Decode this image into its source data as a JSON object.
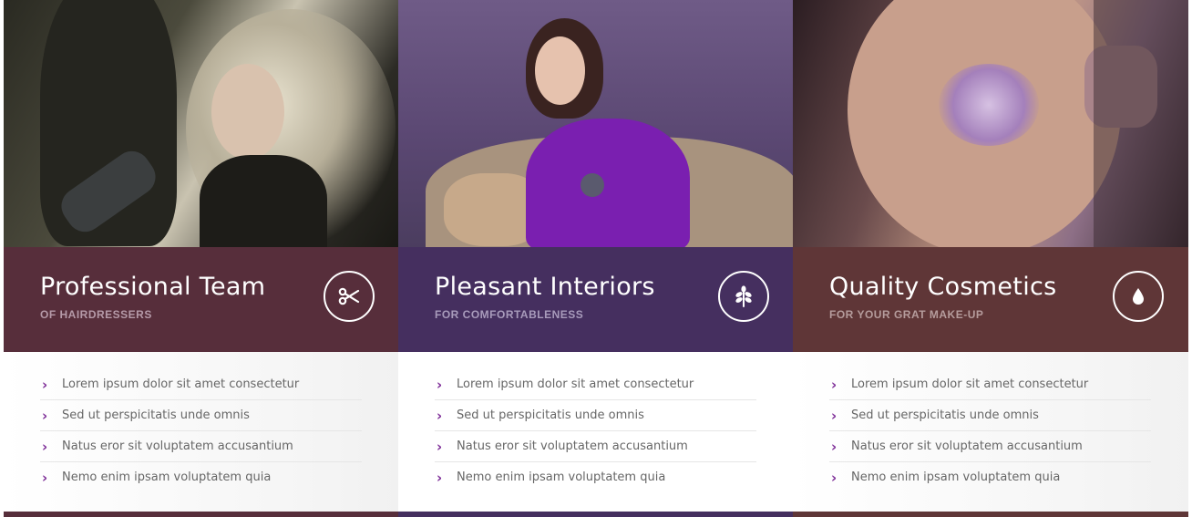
{
  "features": [
    {
      "title": "Professional Team",
      "subtitle": "OF HAIRDRESSERS",
      "icon": "scissors-icon",
      "band_color": "#572e3b",
      "items": [
        "Lorem ipsum dolor sit amet consectetur",
        "Sed ut perspicitatis unde omnis",
        "Natus eror sit voluptatem accusantium",
        "Nemo enim ipsam voluptatem quia"
      ]
    },
    {
      "title": "Pleasant Interiors",
      "subtitle": "FOR COMFORTABLENESS",
      "icon": "leaf-icon",
      "band_color": "#452f5f",
      "items": [
        "Lorem ipsum dolor sit amet consectetur",
        "Sed ut perspicitatis unde omnis",
        "Natus eror sit voluptatem accusantium",
        "Nemo enim ipsam voluptatem quia"
      ]
    },
    {
      "title": "Quality Cosmetics",
      "subtitle": "FOR YOUR GRAT MAKE-UP",
      "icon": "drop-icon",
      "band_color": "#5f3637",
      "items": [
        "Lorem ipsum dolor sit amet consectetur",
        "Sed ut perspicitatis unde omnis",
        "Natus eror sit voluptatem accusantium",
        "Nemo enim ipsam voluptatem quia"
      ]
    }
  ],
  "accent_color": "#7d2c97"
}
